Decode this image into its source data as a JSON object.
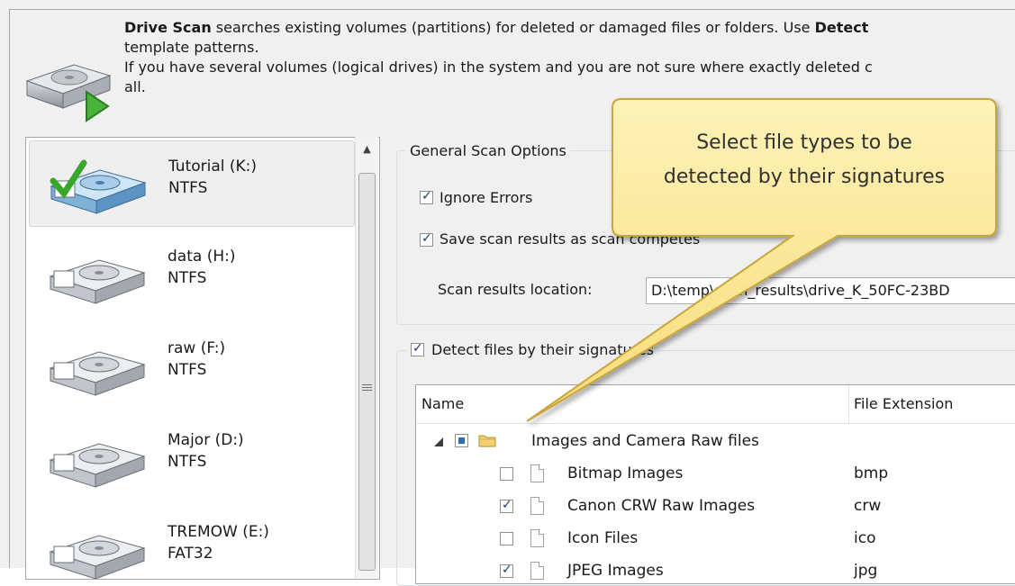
{
  "intro": {
    "line1_bold": "Drive Scan",
    "line1_rest": " searches existing volumes (partitions) for deleted or damaged files or folders. Use ",
    "line1_bold2": "Detect",
    "line2": "template patterns.",
    "line3": "If you have several volumes (logical drives) in the system and you are not sure where exactly deleted c",
    "line4": "all."
  },
  "drives": [
    {
      "name": "Tutorial (K:)",
      "fs": "NTFS",
      "selected": true
    },
    {
      "name": "data (H:)",
      "fs": "NTFS",
      "selected": false
    },
    {
      "name": "raw (F:)",
      "fs": "NTFS",
      "selected": false
    },
    {
      "name": "Major (D:)",
      "fs": "NTFS",
      "selected": false
    },
    {
      "name": "TREMOW (E:)",
      "fs": "FAT32",
      "selected": false
    }
  ],
  "general": {
    "legend": "General Scan Options",
    "ignore_errors": {
      "label": "Ignore Errors",
      "checked": true
    },
    "save_results": {
      "label": "Save scan results as scan competes",
      "checked": true
    },
    "location_label": "Scan results location:",
    "location_value": "D:\\temp\\scan_results\\drive_K_50FC-23BD"
  },
  "signatures": {
    "legend": "Detect files by their signatures",
    "checked": true,
    "columns": {
      "name": "Name",
      "ext": "File Extension"
    },
    "group": {
      "label": "Images and Camera Raw files",
      "state": "partial"
    },
    "items": [
      {
        "label": "Bitmap Images",
        "ext": "bmp",
        "checked": false
      },
      {
        "label": "Canon CRW Raw Images",
        "ext": "crw",
        "checked": true
      },
      {
        "label": "Icon Files",
        "ext": "ico",
        "checked": false
      },
      {
        "label": "JPEG Images",
        "ext": "jpg",
        "checked": true
      }
    ]
  },
  "callout": {
    "line1": "Select file types to be",
    "line2": "detected by their signatures"
  },
  "colors": {
    "callout_fill": "#fbe99a",
    "callout_border": "#c9a53a",
    "check": "#1e3a6e"
  },
  "icons": [
    "drive-scan-icon",
    "hard-drive-icon",
    "checkmark-icon",
    "folder-icon",
    "file-icon",
    "expander-icon"
  ]
}
